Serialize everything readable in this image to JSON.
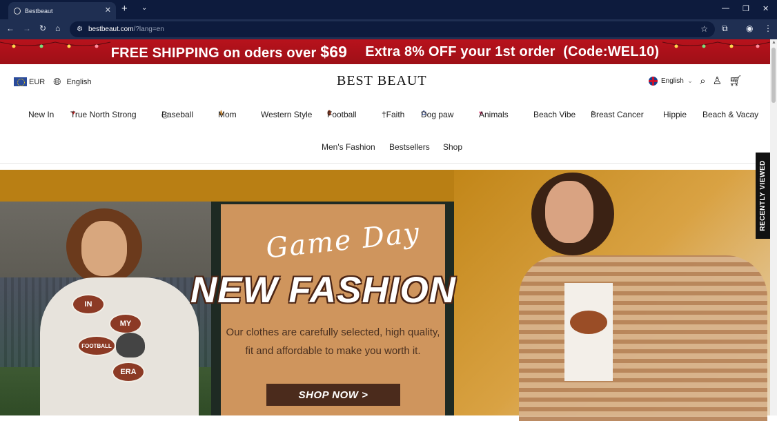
{
  "browser": {
    "tab_title": "Bestbeaut",
    "url_host": "bestbeaut.com",
    "url_path": "/?lang=en"
  },
  "promo": {
    "shipping_text": "FREE SHIPPING on oders over",
    "shipping_amount": "$69",
    "discount_text": "Extra 8% OFF your 1st order",
    "code_text": "(Code:WEL10)"
  },
  "header": {
    "currency": "EUR",
    "language_left": "English",
    "logo_text": "BEST BEAUT",
    "language_right": "English"
  },
  "nav": {
    "row1": [
      "New In",
      "True North Strong",
      "Baseball",
      "Mom",
      "Western Style",
      "Football",
      "†Faith",
      "Dog paw",
      "Animals",
      "Beach Vibe",
      "Breast Cancer",
      "Hippie",
      "Beach & Vacay"
    ],
    "row2": [
      "Men's Fashion",
      "Bestsellers",
      "Shop"
    ]
  },
  "hero": {
    "script_text": "Game Day",
    "headline": "NEW FASHION",
    "tagline_line1": "Our clothes are carefully selected, high quality,",
    "tagline_line2": "fit and affordable to make you worth it.",
    "button": "SHOP NOW >",
    "sweater_balls": [
      "IN",
      "MY",
      "FOOTBALL",
      "ERA"
    ]
  },
  "side_tab": "RECENTLY VIEWED",
  "colors": {
    "promo_red": "#b8121c",
    "hero_gold": "#b97f14",
    "button_brown": "#4b2b1c",
    "chrome_dark": "#0d1b3d"
  }
}
